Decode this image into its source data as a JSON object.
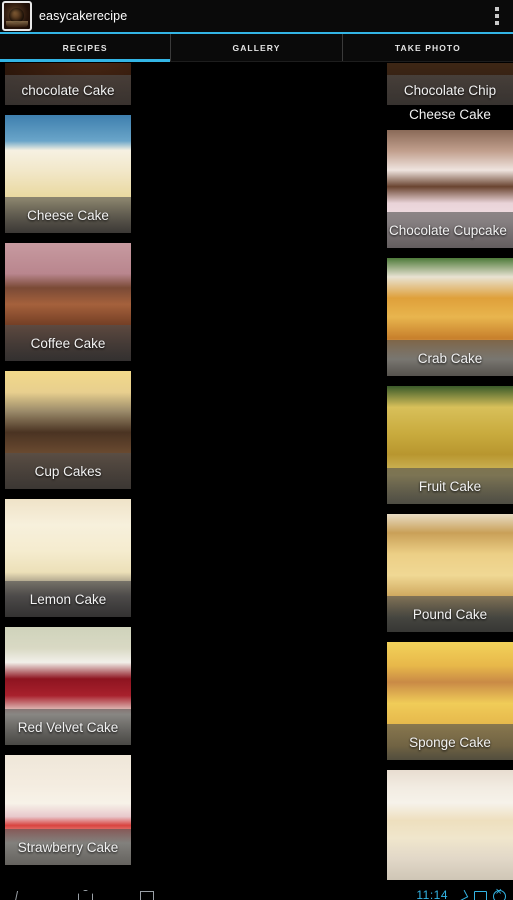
{
  "app": {
    "title": "easycakerecipe",
    "icon": "cake-app-icon",
    "overflow_label": "More options"
  },
  "tabs": [
    {
      "label": "RECIPES",
      "active": true
    },
    {
      "label": "GALLERY",
      "active": false
    },
    {
      "label": "TAKE PHOTO",
      "active": false
    }
  ],
  "theme": {
    "accent": "#33b5e5",
    "background": "#000000",
    "caption_text": "#f2f2f2"
  },
  "grid": {
    "left_column": [
      {
        "title": "chocolate Cake",
        "thumb": "t-chocolate",
        "clipped_top": true
      },
      {
        "title": "Cheese Cake",
        "thumb": "t-cheese"
      },
      {
        "title": "Coffee Cake",
        "thumb": "t-coffee"
      },
      {
        "title": "Cup Cakes",
        "thumb": "t-cupcakes"
      },
      {
        "title": "Lemon Cake",
        "thumb": "t-lemon"
      },
      {
        "title": "Red Velvet Cake",
        "thumb": "t-redvelvet"
      },
      {
        "title": "Strawberry Cake",
        "thumb": "t-strawberry",
        "clipped_bottom": true
      }
    ],
    "right_column": [
      {
        "title": "Chocolate Chip",
        "title_line2": "Cheese Cake",
        "thumb": "t-chocchip",
        "clipped_top": true
      },
      {
        "title": "Chocolate Cupcake",
        "thumb": "t-cupcake1",
        "overflow_text": true
      },
      {
        "title": "Crab Cake",
        "thumb": "t-crab"
      },
      {
        "title": "Fruit Cake",
        "thumb": "t-fruit"
      },
      {
        "title": "Pound Cake",
        "thumb": "t-pound"
      },
      {
        "title": "Sponge Cake",
        "thumb": "t-sponge"
      },
      {
        "title": "",
        "thumb": "t-vanilla",
        "clipped_bottom": true
      }
    ]
  },
  "system_nav": {
    "back_icon": "back-icon",
    "home_icon": "home-icon",
    "recents_icon": "recents-icon",
    "clock": "11:14",
    "share_icon": "share-icon",
    "cast_icon": "screen-icon",
    "cancel_icon": "cancel-icon"
  }
}
